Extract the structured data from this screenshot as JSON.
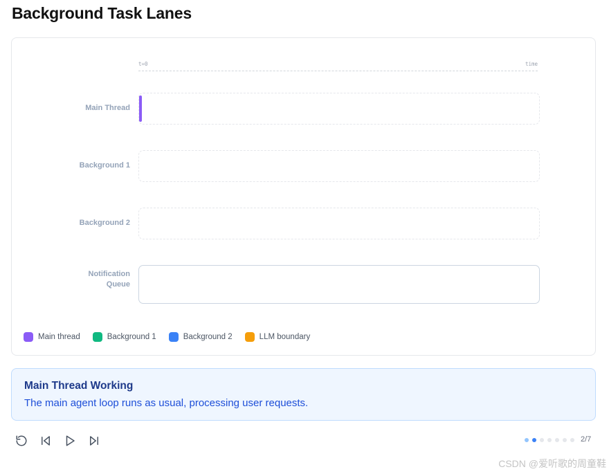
{
  "page_title": "Background Task Lanes",
  "timeline": {
    "axis_start": "t=0",
    "axis_end": "time"
  },
  "lanes": [
    {
      "label": "Main Thread"
    },
    {
      "label": "Background 1"
    },
    {
      "label": "Background 2"
    },
    {
      "label": "Notification\nQueue"
    }
  ],
  "legend": [
    {
      "label": "Main thread",
      "color": "#8b5cf6"
    },
    {
      "label": "Background 1",
      "color": "#10b981"
    },
    {
      "label": "Background 2",
      "color": "#3b82f6"
    },
    {
      "label": "LLM boundary",
      "color": "#f59e0b"
    }
  ],
  "info": {
    "title": "Main Thread Working",
    "text": "The main agent loop runs as usual, processing user requests."
  },
  "pagination": {
    "current": 2,
    "total": 7,
    "label": "2/7"
  },
  "watermark": "CSDN @爱听歌的周童鞋"
}
